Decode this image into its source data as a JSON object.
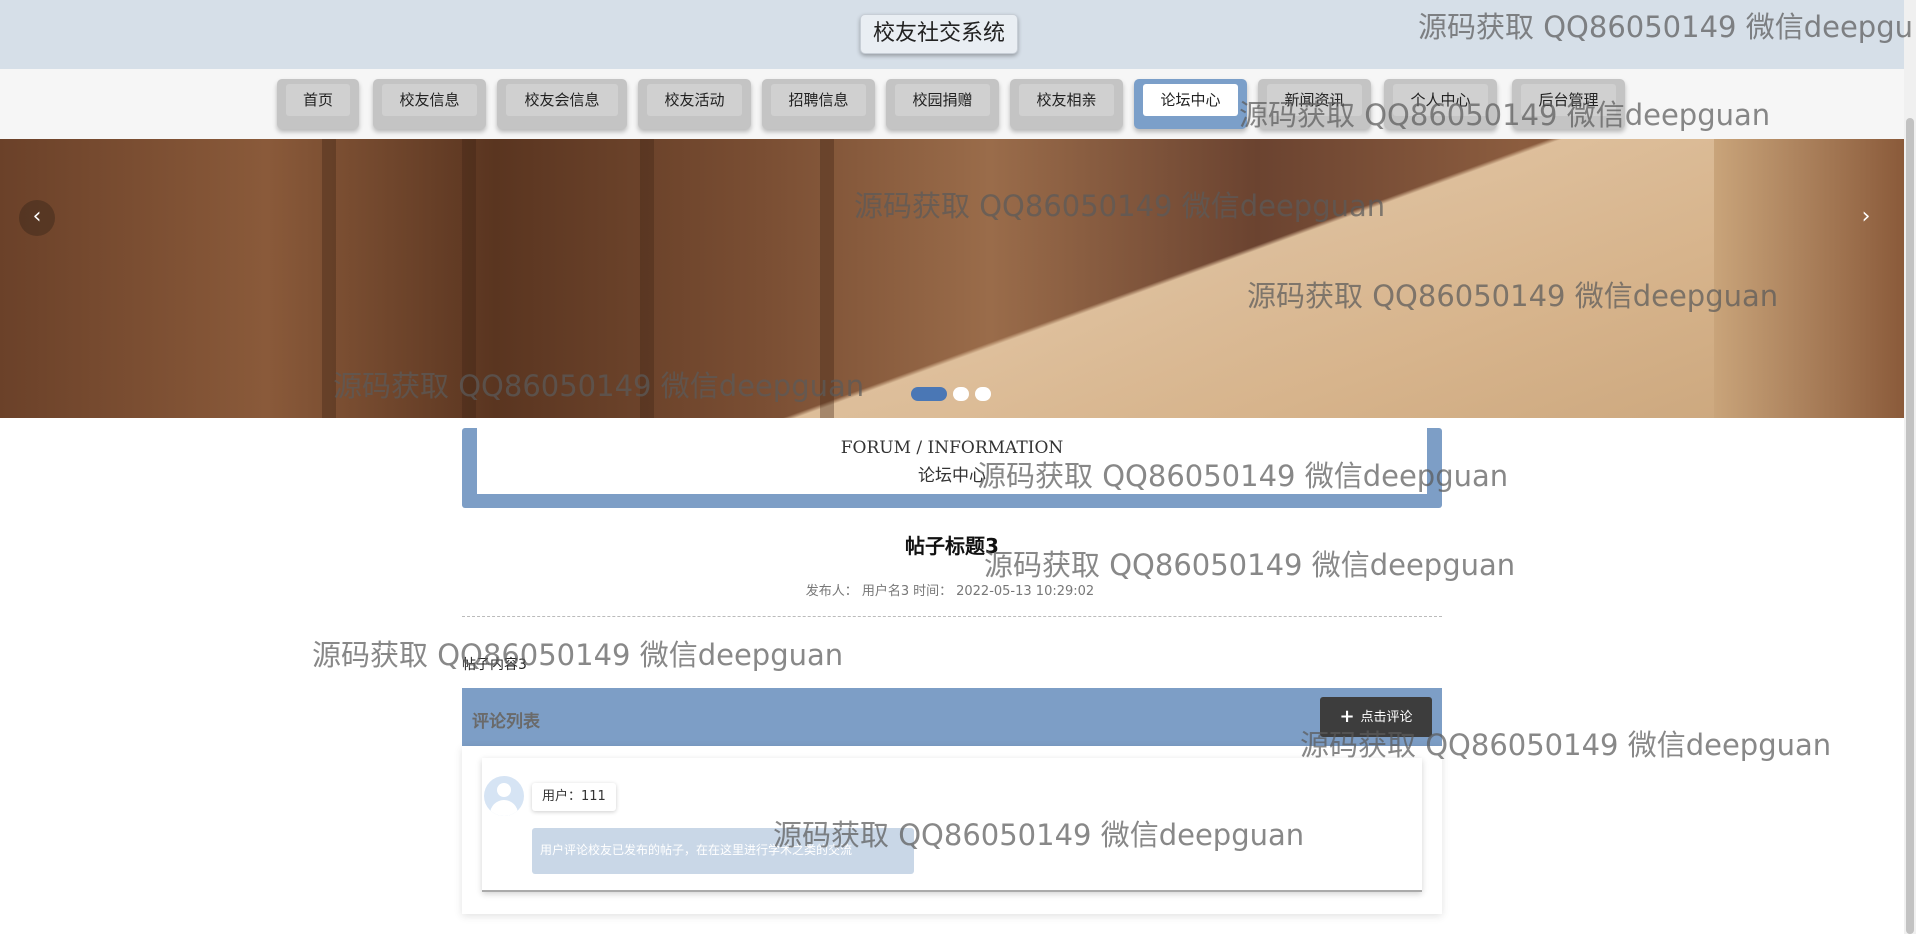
{
  "header": {
    "title": "校友社交系统"
  },
  "nav": {
    "items": [
      {
        "label": "首页",
        "active": false
      },
      {
        "label": "校友信息",
        "active": false
      },
      {
        "label": "校友会信息",
        "active": false
      },
      {
        "label": "校友活动",
        "active": false
      },
      {
        "label": "招聘信息",
        "active": false
      },
      {
        "label": "校园捐赠",
        "active": false
      },
      {
        "label": "校友相亲",
        "active": false
      },
      {
        "label": "论坛中心",
        "active": true
      },
      {
        "label": "新闻资讯",
        "active": false
      },
      {
        "label": "个人中心",
        "active": false
      },
      {
        "label": "后台管理",
        "active": false
      }
    ]
  },
  "banner": {
    "arrow_left": "‹",
    "arrow_right": "›",
    "slide_count": 3,
    "active_slide": 1
  },
  "section": {
    "title_en": "FORUM / INFORMATION",
    "title_cn": "论坛中心"
  },
  "post": {
    "title": "帖子标题3",
    "author_label": "发布人：",
    "author": "用户名3",
    "time_label": "时间：",
    "time": "2022-05-13 10:29:02",
    "content": "帖子内容3"
  },
  "comments": {
    "title": "评论列表",
    "add_button": "点击评论",
    "add_icon": "+",
    "items": [
      {
        "user_label": "用户：",
        "user": "111",
        "text": "用户评论校友已发布的帖子，在在这里进行学术之类的交流"
      }
    ]
  },
  "watermark": {
    "text": "源码获取 QQ86050149 微信deepguan",
    "text_cut": "源码获取 QQ86050149 微信deepgu"
  },
  "colors": {
    "accent": "#7d9ec6",
    "header_bg": "#d6dfe8",
    "active_dot": "#4a77b5"
  }
}
